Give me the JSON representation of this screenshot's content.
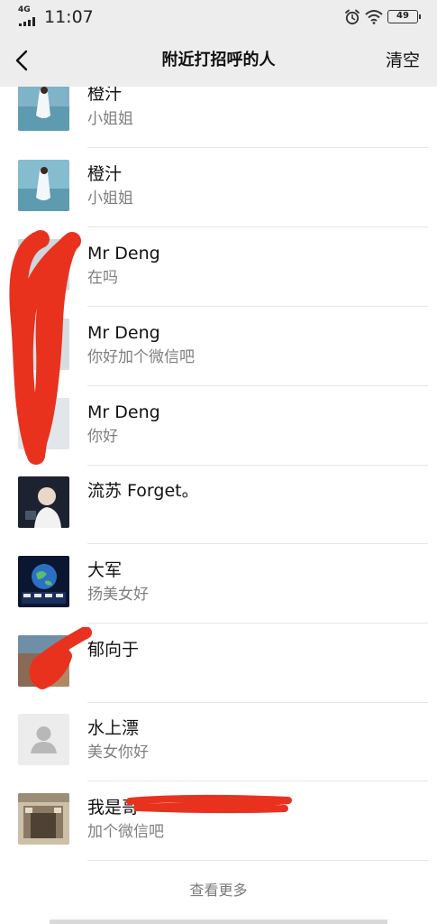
{
  "status": {
    "network": "4G",
    "time": "11:07",
    "battery": "49"
  },
  "nav": {
    "title": "附近打招呼的人",
    "clear_label": "清空"
  },
  "list": [
    {
      "name": "橙汁",
      "message": "小姐姐"
    },
    {
      "name": "橙汁",
      "message": "小姐姐"
    },
    {
      "name": "Mr Deng",
      "message": "在吗"
    },
    {
      "name": "Mr Deng",
      "message": "你好加个微信吧"
    },
    {
      "name": "Mr Deng",
      "message": "你好"
    },
    {
      "name": "流苏 Forget。",
      "message": ""
    },
    {
      "name": "大军",
      "message": "扬美女好"
    },
    {
      "name": "郁向于",
      "message": ""
    },
    {
      "name": "水上漂",
      "message": "美女你好"
    },
    {
      "name": "我是哥",
      "message": "加个微信吧"
    }
  ],
  "footer": {
    "more_label": "查看更多"
  },
  "colors": {
    "header_bg": "#ededed",
    "scribble": "#e8321e",
    "secondary_text": "#7f7f7f"
  }
}
